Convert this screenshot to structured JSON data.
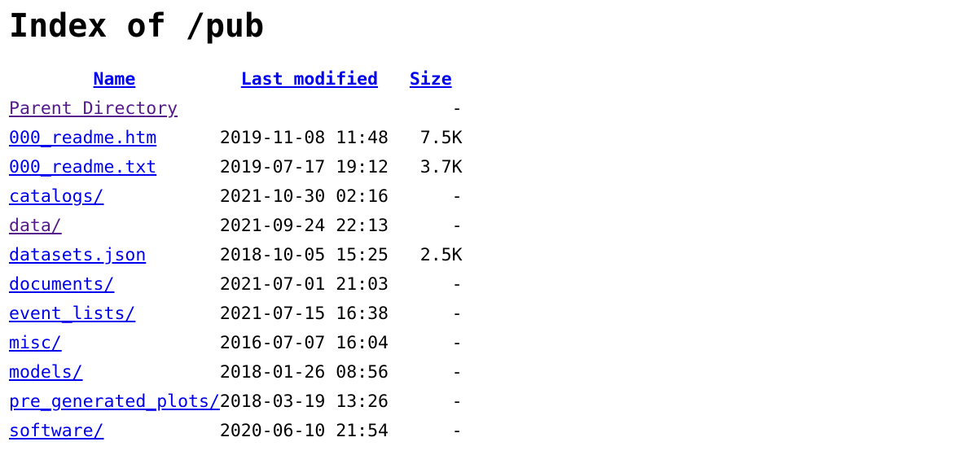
{
  "page": {
    "title": "Index of /pub",
    "link_color": "#0000ee",
    "visited_link_color": "#551a8b",
    "text_color": "#000000",
    "background_color": "#ffffff"
  },
  "table": {
    "headers": {
      "name": "Name",
      "last_modified": "Last modified",
      "size": "Size"
    },
    "rows": [
      {
        "name": "Parent Directory",
        "last_modified": "",
        "size": "-",
        "visited": true,
        "type": "parent"
      },
      {
        "name": "000_readme.htm",
        "last_modified": "2019-11-08 11:48",
        "size": "7.5K",
        "visited": false,
        "type": "file"
      },
      {
        "name": "000_readme.txt",
        "last_modified": "2019-07-17 19:12",
        "size": "3.7K",
        "visited": false,
        "type": "file"
      },
      {
        "name": "catalogs/",
        "last_modified": "2021-10-30 02:16",
        "size": "-",
        "visited": false,
        "type": "directory"
      },
      {
        "name": "data/",
        "last_modified": "2021-09-24 22:13",
        "size": "-",
        "visited": true,
        "type": "directory"
      },
      {
        "name": "datasets.json",
        "last_modified": "2018-10-05 15:25",
        "size": "2.5K",
        "visited": false,
        "type": "file"
      },
      {
        "name": "documents/",
        "last_modified": "2021-07-01 21:03",
        "size": "-",
        "visited": false,
        "type": "directory"
      },
      {
        "name": "event_lists/",
        "last_modified": "2021-07-15 16:38",
        "size": "-",
        "visited": false,
        "type": "directory"
      },
      {
        "name": "misc/",
        "last_modified": "2016-07-07 16:04",
        "size": "-",
        "visited": false,
        "type": "directory"
      },
      {
        "name": "models/",
        "last_modified": "2018-01-26 08:56",
        "size": "-",
        "visited": false,
        "type": "directory"
      },
      {
        "name": "pre_generated_plots/",
        "last_modified": "2018-03-19 13:26",
        "size": "-",
        "visited": false,
        "type": "directory"
      },
      {
        "name": "software/",
        "last_modified": "2020-06-10 21:54",
        "size": "-",
        "visited": false,
        "type": "directory"
      }
    ]
  }
}
